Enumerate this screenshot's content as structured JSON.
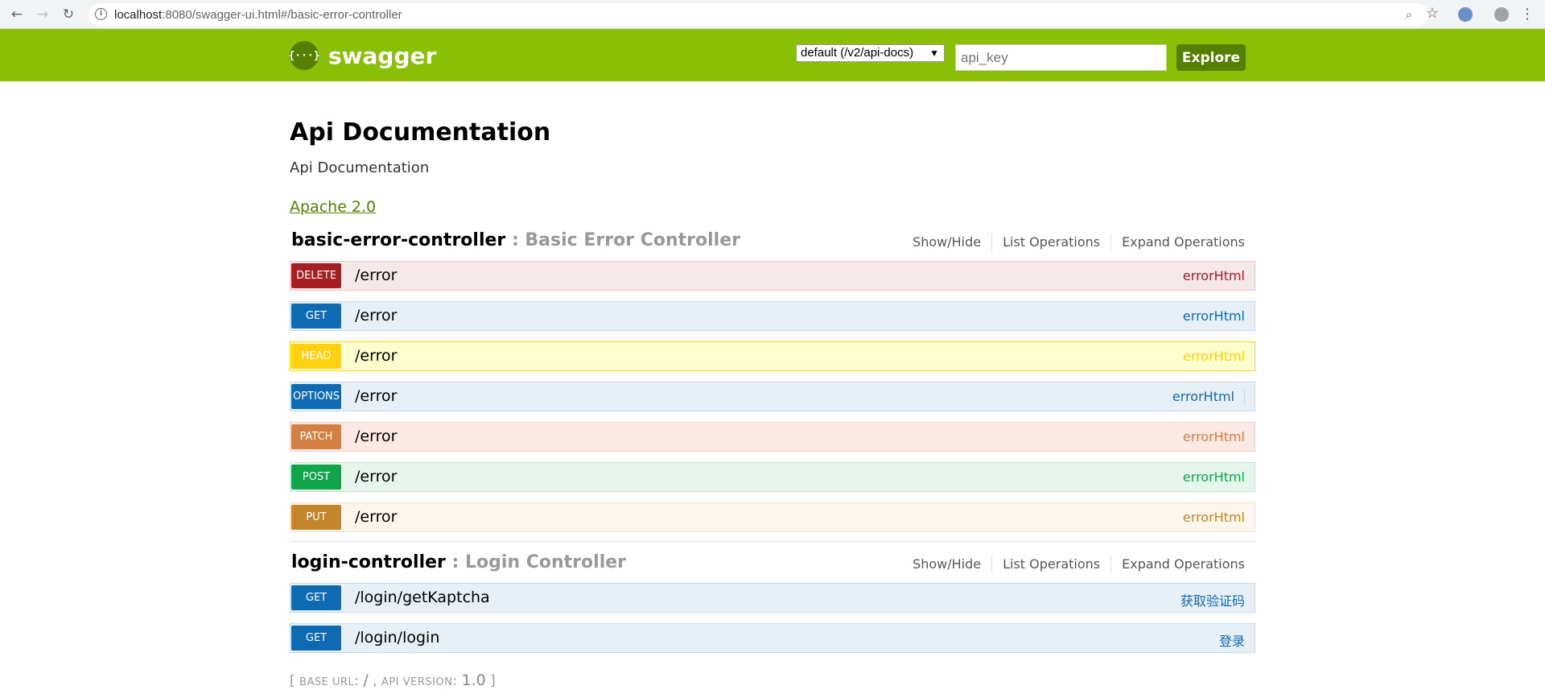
{
  "browser": {
    "url_host": "localhost",
    "url_rest": ":8080/swagger-ui.html#/basic-error-controller",
    "back_glyph": "←",
    "forward_glyph": "→",
    "reload_glyph": "↻",
    "info_glyph": "i",
    "zoom_glyph": "⌕",
    "star_glyph": "☆",
    "menu_glyph": "⋮"
  },
  "header": {
    "logo_mark": "{···}",
    "logo_text": "swagger",
    "spec_select": "default (/v2/api-docs)",
    "spec_arrow": "▼",
    "api_key_placeholder": "api_key",
    "explore_label": "Explore",
    "brand_color": "#89bf04"
  },
  "info": {
    "title": "Api Documentation",
    "description": "Api Documentation",
    "license": "Apache 2.0"
  },
  "resources": [
    {
      "name": "basic-error-controller",
      "sep": " : ",
      "description": "Basic Error Controller",
      "actions": [
        "Show/Hide",
        "List Operations",
        "Expand Operations"
      ],
      "operations": [
        {
          "method": "DELETE",
          "path": "/error",
          "summary": "errorHtml",
          "color": "#a41e22",
          "bg": "#f5e8e8",
          "border": "#e8c6c7",
          "text": "#a41e22"
        },
        {
          "method": "GET",
          "path": "/error",
          "summary": "errorHtml",
          "color": "#0f6ab4",
          "bg": "#e7f0f7",
          "border": "#c3d9ec",
          "text": "#0f6ab4"
        },
        {
          "method": "HEAD",
          "path": "/error",
          "summary": "errorHtml",
          "color": "#ffd20f",
          "bg": "#fcffcd",
          "border": "#ffd20f",
          "text": "#ffd20f"
        },
        {
          "method": "OPTIONS",
          "path": "/error",
          "summary": "errorHtml",
          "color": "#0f6ab4",
          "bg": "#e7f0f7",
          "border": "#c3d9ec",
          "text": "#0f6ab4"
        },
        {
          "method": "PATCH",
          "path": "/error",
          "summary": "errorHtml",
          "color": "#d38042",
          "bg": "#fce9e3",
          "border": "#f0cecb",
          "text": "#d38042"
        },
        {
          "method": "POST",
          "path": "/error",
          "summary": "errorHtml",
          "color": "#10a54a",
          "bg": "#e7f6ec",
          "border": "#c3e8d1",
          "text": "#10a54a"
        },
        {
          "method": "PUT",
          "path": "/error",
          "summary": "errorHtml",
          "color": "#c5862b",
          "bg": "#fcf6ed",
          "border": "#f0e0ca",
          "text": "#c5862b"
        }
      ]
    },
    {
      "name": "login-controller",
      "sep": " : ",
      "description": "Login Controller",
      "actions": [
        "Show/Hide",
        "List Operations",
        "Expand Operations"
      ],
      "operations": [
        {
          "method": "GET",
          "path": "/login/getKaptcha",
          "summary": "获取验证码",
          "color": "#0f6ab4",
          "bg": "#e7f0f7",
          "border": "#c3d9ec",
          "text": "#0f6ab4"
        },
        {
          "method": "GET",
          "path": "/login/login",
          "summary": "登录",
          "color": "#0f6ab4",
          "bg": "#e7f0f7",
          "border": "#c3d9ec",
          "text": "#0f6ab4"
        }
      ]
    }
  ],
  "footer": {
    "open": "[ ",
    "base_url_label": "BASE URL",
    "colon": ": ",
    "base_url": "/",
    "comma": " , ",
    "api_version_label": "API VERSION",
    "api_version": "1.0",
    "close": " ]"
  }
}
